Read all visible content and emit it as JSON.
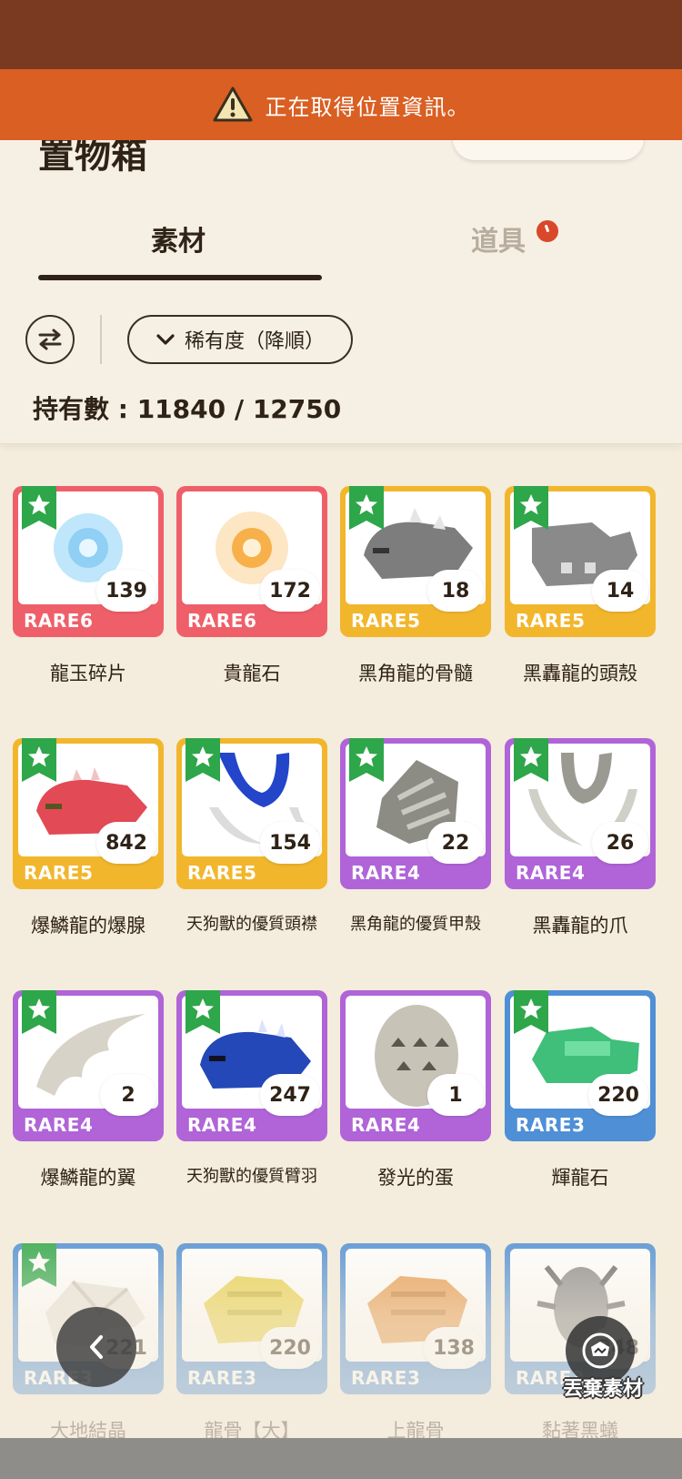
{
  "banner": {
    "icon": "warning-icon",
    "text": "正在取得位置資訊。"
  },
  "page": {
    "title": "置物箱"
  },
  "tabs": [
    {
      "label": "素材",
      "active": true
    },
    {
      "label": "道具",
      "active": false,
      "badge": "clock-icon"
    }
  ],
  "toolbar": {
    "swap_icon": "swap-arrows-icon",
    "sort_label": "稀有度（降順）",
    "sort_icon": "chevron-down-icon"
  },
  "inventory": {
    "count_text": "持有數 : 11840 / 12750"
  },
  "colors": {
    "rare6": "#ef5f6a",
    "rare5": "#f2b62d",
    "rare4": "#b064d8",
    "rare3": "#4f8fd6",
    "banner": "#d95f22",
    "statusbar": "#7a3a22",
    "star": "#2ea64a"
  },
  "items": [
    {
      "name": "龍玉碎片",
      "rarity": "RARE6",
      "qty": "139",
      "starred": true,
      "icon": "dragon-jewel-icon"
    },
    {
      "name": "貴龍石",
      "rarity": "RARE6",
      "qty": "172",
      "starred": false,
      "icon": "sun-stone-icon"
    },
    {
      "name": "黑角龍的骨髓",
      "rarity": "RARE5",
      "qty": "18",
      "starred": true,
      "icon": "monster-head-icon"
    },
    {
      "name": "黑轟龍的頭殼",
      "rarity": "RARE5",
      "qty": "14",
      "starred": true,
      "icon": "skull-block-icon"
    },
    {
      "name": "爆鱗龍的爆腺",
      "rarity": "RARE5",
      "qty": "842",
      "starred": true,
      "icon": "red-head-icon"
    },
    {
      "name": "天狗獸的優質頭襟",
      "rarity": "RARE5",
      "qty": "154",
      "starred": true,
      "icon": "blue-horns-icon"
    },
    {
      "name": "黑角龍的優質甲殼",
      "rarity": "RARE4",
      "qty": "22",
      "starred": true,
      "icon": "shell-icon"
    },
    {
      "name": "黑轟龍的爪",
      "rarity": "RARE4",
      "qty": "26",
      "starred": true,
      "icon": "claws-icon"
    },
    {
      "name": "爆鱗龍的翼",
      "rarity": "RARE4",
      "qty": "2",
      "starred": true,
      "icon": "wing-icon"
    },
    {
      "name": "天狗獸的優質臂羽",
      "rarity": "RARE4",
      "qty": "247",
      "starred": true,
      "icon": "blue-head-icon"
    },
    {
      "name": "發光的蛋",
      "rarity": "RARE4",
      "qty": "1",
      "starred": false,
      "icon": "egg-icon"
    },
    {
      "name": "輝龍石",
      "rarity": "RARE3",
      "qty": "220",
      "starred": true,
      "icon": "green-ore-icon"
    },
    {
      "name": "大地結晶",
      "rarity": "RARE3",
      "qty": "221",
      "starred": true,
      "icon": "crystal-icon"
    },
    {
      "name": "龍骨【大】",
      "rarity": "RARE3",
      "qty": "220",
      "starred": false,
      "icon": "yellow-bone-icon"
    },
    {
      "name": "上龍骨",
      "rarity": "RARE3",
      "qty": "138",
      "starred": false,
      "icon": "orange-bone-icon"
    },
    {
      "name": "黏著黑蟻",
      "rarity": "RARE3",
      "qty": "248",
      "starred": false,
      "icon": "ant-icon"
    }
  ],
  "actions": {
    "back_icon": "chevron-left-icon",
    "discard_label": "丟棄素材",
    "discard_icon": "discard-icon"
  }
}
